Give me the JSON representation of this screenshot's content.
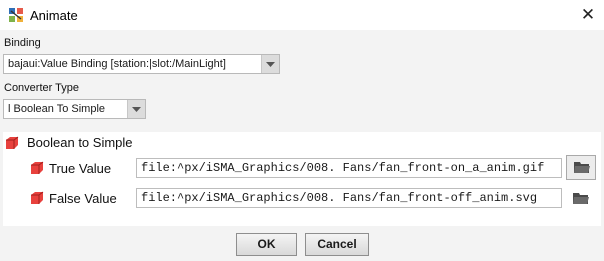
{
  "window": {
    "title": "Animate",
    "close_symbol": "✕"
  },
  "binding": {
    "label": "Binding",
    "value": "bajaui:Value Binding [station:|slot:/MainLight]"
  },
  "converter": {
    "label": "Converter Type",
    "value": "l Boolean To Simple"
  },
  "group": {
    "label": "Boolean to Simple",
    "rows": [
      {
        "label": "True Value",
        "value": "file:^px/iSMA_Graphics/008. Fans/fan_front-on_a_anim.gif"
      },
      {
        "label": "False Value",
        "value": "file:^px/iSMA_Graphics/008. Fans/fan_front-off_anim.svg"
      }
    ]
  },
  "buttons": {
    "ok": "OK",
    "cancel": "Cancel"
  },
  "icons": [
    "app-icon",
    "close-icon",
    "chevron-down-icon",
    "property-cube-icon",
    "folder-icon"
  ],
  "colors": {
    "cube": "#e8413d",
    "folder": "#4a4a4a"
  }
}
